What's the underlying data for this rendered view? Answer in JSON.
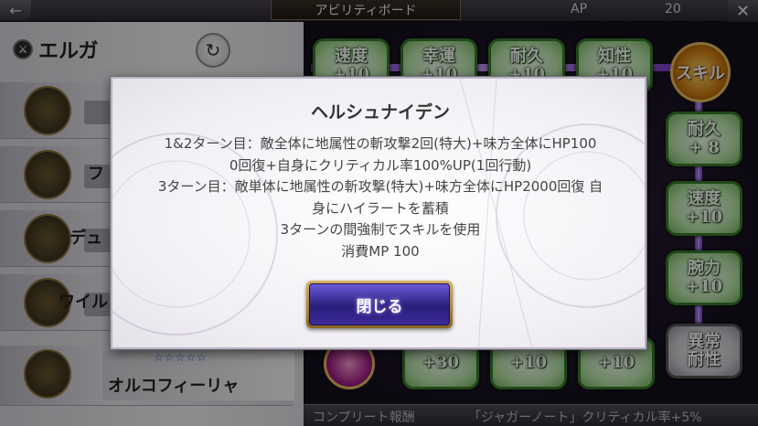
{
  "header": {
    "title": "アビリティボード",
    "ap_label": "AP",
    "ap_value": "20",
    "back_icon": "back-arrow-icon",
    "close_icon": "close-icon"
  },
  "character": {
    "name": "エルガ",
    "rows": [
      {
        "name": "フ"
      },
      {
        "name": "デュ"
      },
      {
        "name": "ワイル"
      },
      {
        "name": "オルコフィーリャ",
        "stars": "☆☆☆☆☆"
      }
    ]
  },
  "board": {
    "top_nodes": [
      {
        "label": "速度",
        "value": "+10"
      },
      {
        "label": "幸運",
        "value": "+10"
      },
      {
        "label": "耐久",
        "value": "+10"
      },
      {
        "label": "知性",
        "value": "+10"
      }
    ],
    "skill_node_label": "スキル",
    "right_nodes": [
      {
        "label": "耐久",
        "value": "+ 8"
      },
      {
        "label": "速度",
        "value": "+10"
      },
      {
        "label": "腕力",
        "value": "+10"
      },
      {
        "label": "異常",
        "value": "耐性"
      }
    ],
    "bottom_nodes": [
      {
        "value": "+30"
      },
      {
        "value": "+10"
      },
      {
        "value": "+10"
      }
    ]
  },
  "footer": {
    "complete_label": "コンプリート報酬",
    "complete_reward": "「ジャガーノート」クリティカル率+5%"
  },
  "modal": {
    "title": "ヘルシュナイデン",
    "lines": [
      "1&2ターン目：敵全体に地属性の斬攻撃2回(特大)+味方全体にHP100",
      "0回復+自身にクリティカル率100%UP(1回行動)",
      "3ターン目：敵単体に地属性の斬攻撃(特大)+味方全体にHP2000回復 自",
      "身にハイラートを蓄積",
      "3ターンの間強制でスキルを使用",
      "消費MP 100"
    ],
    "close_label": "閉じる"
  },
  "colors": {
    "node_green": "#76b860",
    "modal_bg": "#f1eff4",
    "button_blue": "#2a1e7a",
    "button_gold": "#d4b060"
  }
}
